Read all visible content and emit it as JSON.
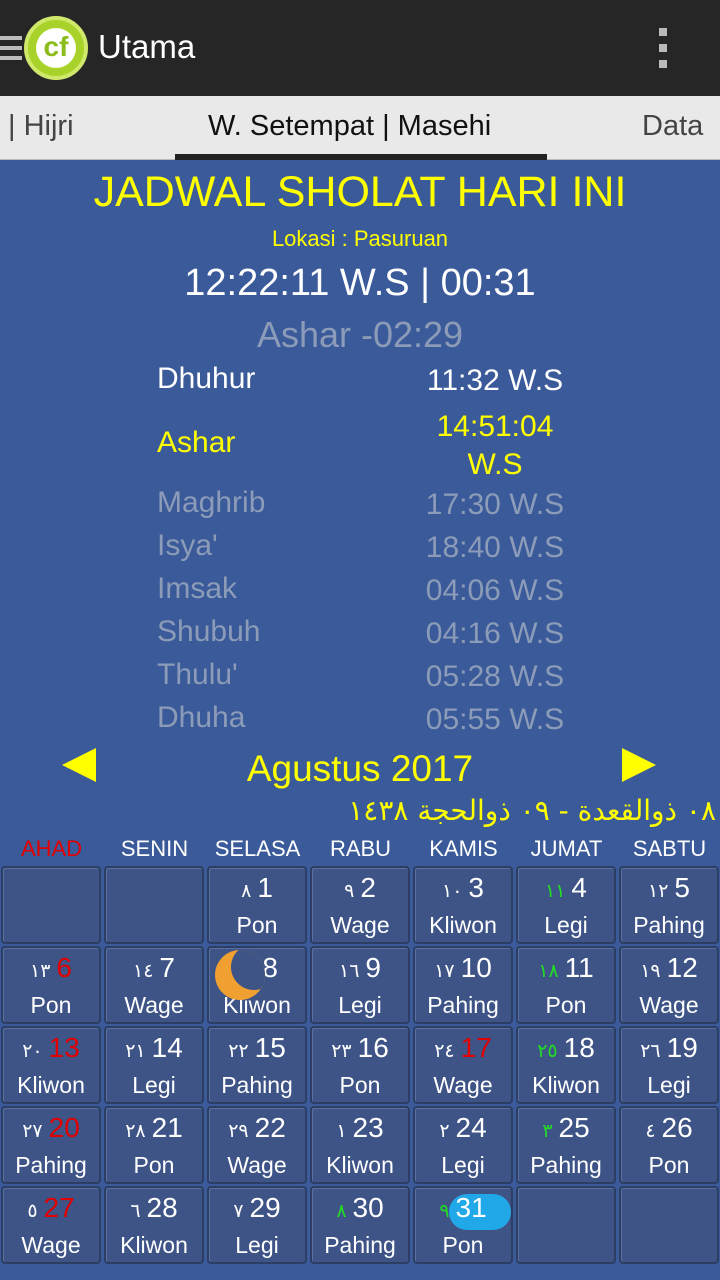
{
  "app": {
    "title": "Utama"
  },
  "tabs": [
    {
      "label": "| Hijri",
      "active": false
    },
    {
      "label": "W. Setempat | Masehi",
      "active": true
    },
    {
      "label": "Data",
      "active": false
    }
  ],
  "schedule": {
    "title": "JADWAL SHOLAT HARI INI",
    "location": "Lokasi : Pasuruan",
    "clock": "12:22:11 W.S | 00:31",
    "next": "Ashar -02:29",
    "prayers": [
      {
        "name": "Dhuhur",
        "time": "11:32 W.S",
        "state": "current"
      },
      {
        "name": "Ashar",
        "time": "14:51:04 W.S",
        "state": "next"
      },
      {
        "name": "Maghrib",
        "time": "17:30 W.S",
        "state": "dim"
      },
      {
        "name": "Isya'",
        "time": "18:40 W.S",
        "state": "dim"
      },
      {
        "name": "Imsak",
        "time": "04:06 W.S",
        "state": "dim"
      },
      {
        "name": "Shubuh",
        "time": "04:16 W.S",
        "state": "dim"
      },
      {
        "name": "Thulu'",
        "time": "05:28 W.S",
        "state": "dim"
      },
      {
        "name": "Dhuha",
        "time": "05:55 W.S",
        "state": "dim"
      }
    ]
  },
  "calendar": {
    "month_label": "Agustus 2017",
    "hijri_label": "٠٨ ذوالقعدة - ٠٩ ذوالحجة ١٤٣٨",
    "day_headers": [
      "AHAD",
      "SENIN",
      "SELASA",
      "RABU",
      "KAMIS",
      "JUMAT",
      "SABTU"
    ],
    "colors": {
      "sunday": "#e00000",
      "friday_hijri": "#22dd22",
      "today": "#20a8e8",
      "moon": "#f0a030"
    },
    "cells": [
      {
        "h": "",
        "d": "",
        "p": ""
      },
      {
        "h": "",
        "d": "",
        "p": ""
      },
      {
        "h": "٨",
        "d": "1",
        "p": "Pon"
      },
      {
        "h": "٩",
        "d": "2",
        "p": "Wage"
      },
      {
        "h": "١٠",
        "d": "3",
        "p": "Kliwon"
      },
      {
        "h": "١١",
        "d": "4",
        "p": "Legi"
      },
      {
        "h": "١٢",
        "d": "5",
        "p": "Pahing"
      },
      {
        "h": "١٣",
        "d": "6",
        "p": "Pon"
      },
      {
        "h": "١٤",
        "d": "7",
        "p": "Wage"
      },
      {
        "h": "١٥",
        "d": "8",
        "p": "Kliwon"
      },
      {
        "h": "١٦",
        "d": "9",
        "p": "Legi"
      },
      {
        "h": "١٧",
        "d": "10",
        "p": "Pahing"
      },
      {
        "h": "١٨",
        "d": "11",
        "p": "Pon"
      },
      {
        "h": "١٩",
        "d": "12",
        "p": "Wage"
      },
      {
        "h": "٢٠",
        "d": "13",
        "p": "Kliwon"
      },
      {
        "h": "٢١",
        "d": "14",
        "p": "Legi"
      },
      {
        "h": "٢٢",
        "d": "15",
        "p": "Pahing"
      },
      {
        "h": "٢٣",
        "d": "16",
        "p": "Pon"
      },
      {
        "h": "٢٤",
        "d": "17",
        "p": "Wage"
      },
      {
        "h": "٢٥",
        "d": "18",
        "p": "Kliwon"
      },
      {
        "h": "٢٦",
        "d": "19",
        "p": "Legi"
      },
      {
        "h": "٢٧",
        "d": "20",
        "p": "Pahing"
      },
      {
        "h": "٢٨",
        "d": "21",
        "p": "Pon"
      },
      {
        "h": "٢٩",
        "d": "22",
        "p": "Wage"
      },
      {
        "h": "١",
        "d": "23",
        "p": "Kliwon"
      },
      {
        "h": "٢",
        "d": "24",
        "p": "Legi"
      },
      {
        "h": "٣",
        "d": "25",
        "p": "Pahing"
      },
      {
        "h": "٤",
        "d": "26",
        "p": "Pon"
      },
      {
        "h": "٥",
        "d": "27",
        "p": "Wage"
      },
      {
        "h": "٦",
        "d": "28",
        "p": "Kliwon"
      },
      {
        "h": "٧",
        "d": "29",
        "p": "Legi"
      },
      {
        "h": "٨",
        "d": "30",
        "p": "Pahing"
      },
      {
        "h": "٩",
        "d": "31",
        "p": "Pon"
      },
      {
        "h": "",
        "d": "",
        "p": ""
      },
      {
        "h": "",
        "d": "",
        "p": ""
      }
    ],
    "red_days": [
      "6",
      "13",
      "17",
      "20",
      "27"
    ],
    "green_hijri_days": [
      "4",
      "11",
      "18",
      "25",
      "30",
      "31"
    ],
    "moon_day": "8",
    "today": "31"
  }
}
